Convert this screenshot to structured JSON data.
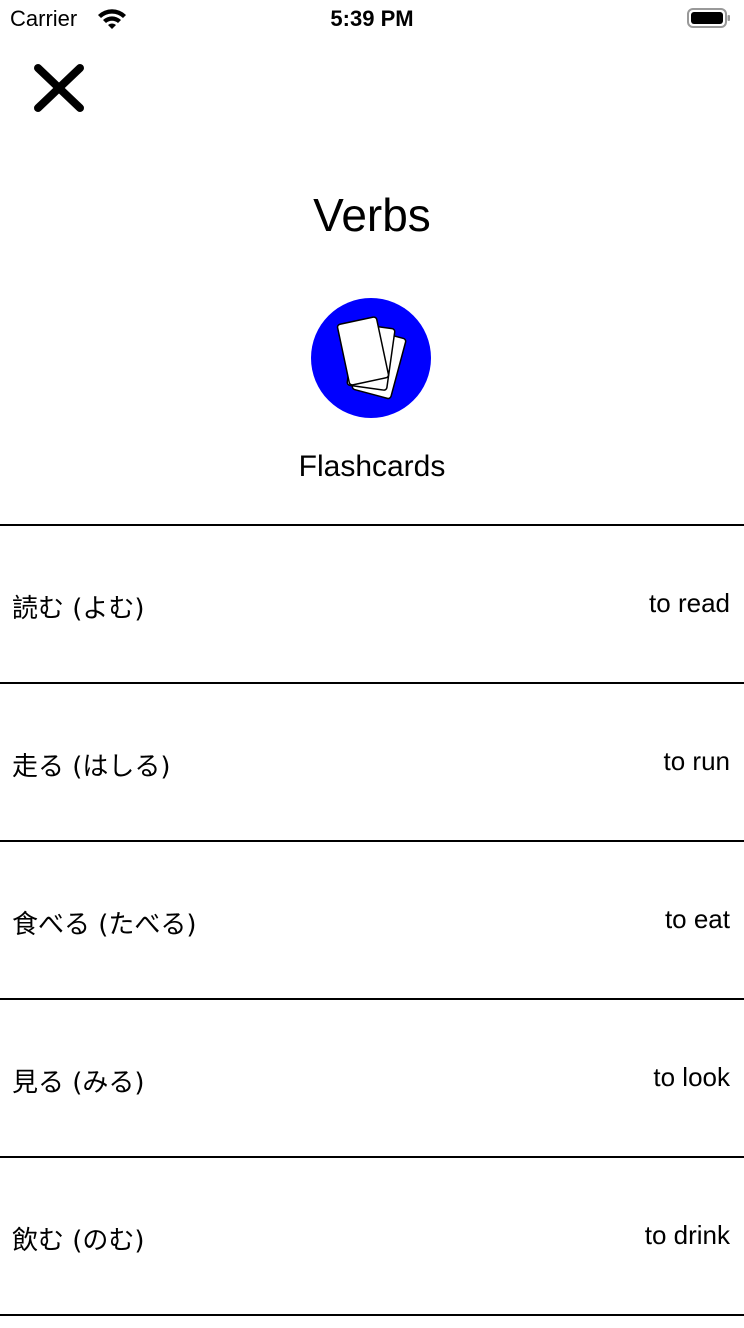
{
  "status_bar": {
    "carrier": "Carrier",
    "time": "5:39 PM",
    "wifi_icon": "wifi-icon",
    "battery_icon": "battery-full-icon"
  },
  "header": {
    "close_icon": "close-icon",
    "title": "Verbs"
  },
  "mode": {
    "icon": "flashcards-icon",
    "icon_color": "#0000ff",
    "label": "Flashcards"
  },
  "words": [
    {
      "japanese": "読む (よむ)",
      "english": "to read"
    },
    {
      "japanese": "走る (はしる)",
      "english": "to run"
    },
    {
      "japanese": "食べる (たべる)",
      "english": "to eat"
    },
    {
      "japanese": "見る (みる)",
      "english": "to look"
    },
    {
      "japanese": "飲む (のむ)",
      "english": "to drink"
    }
  ]
}
